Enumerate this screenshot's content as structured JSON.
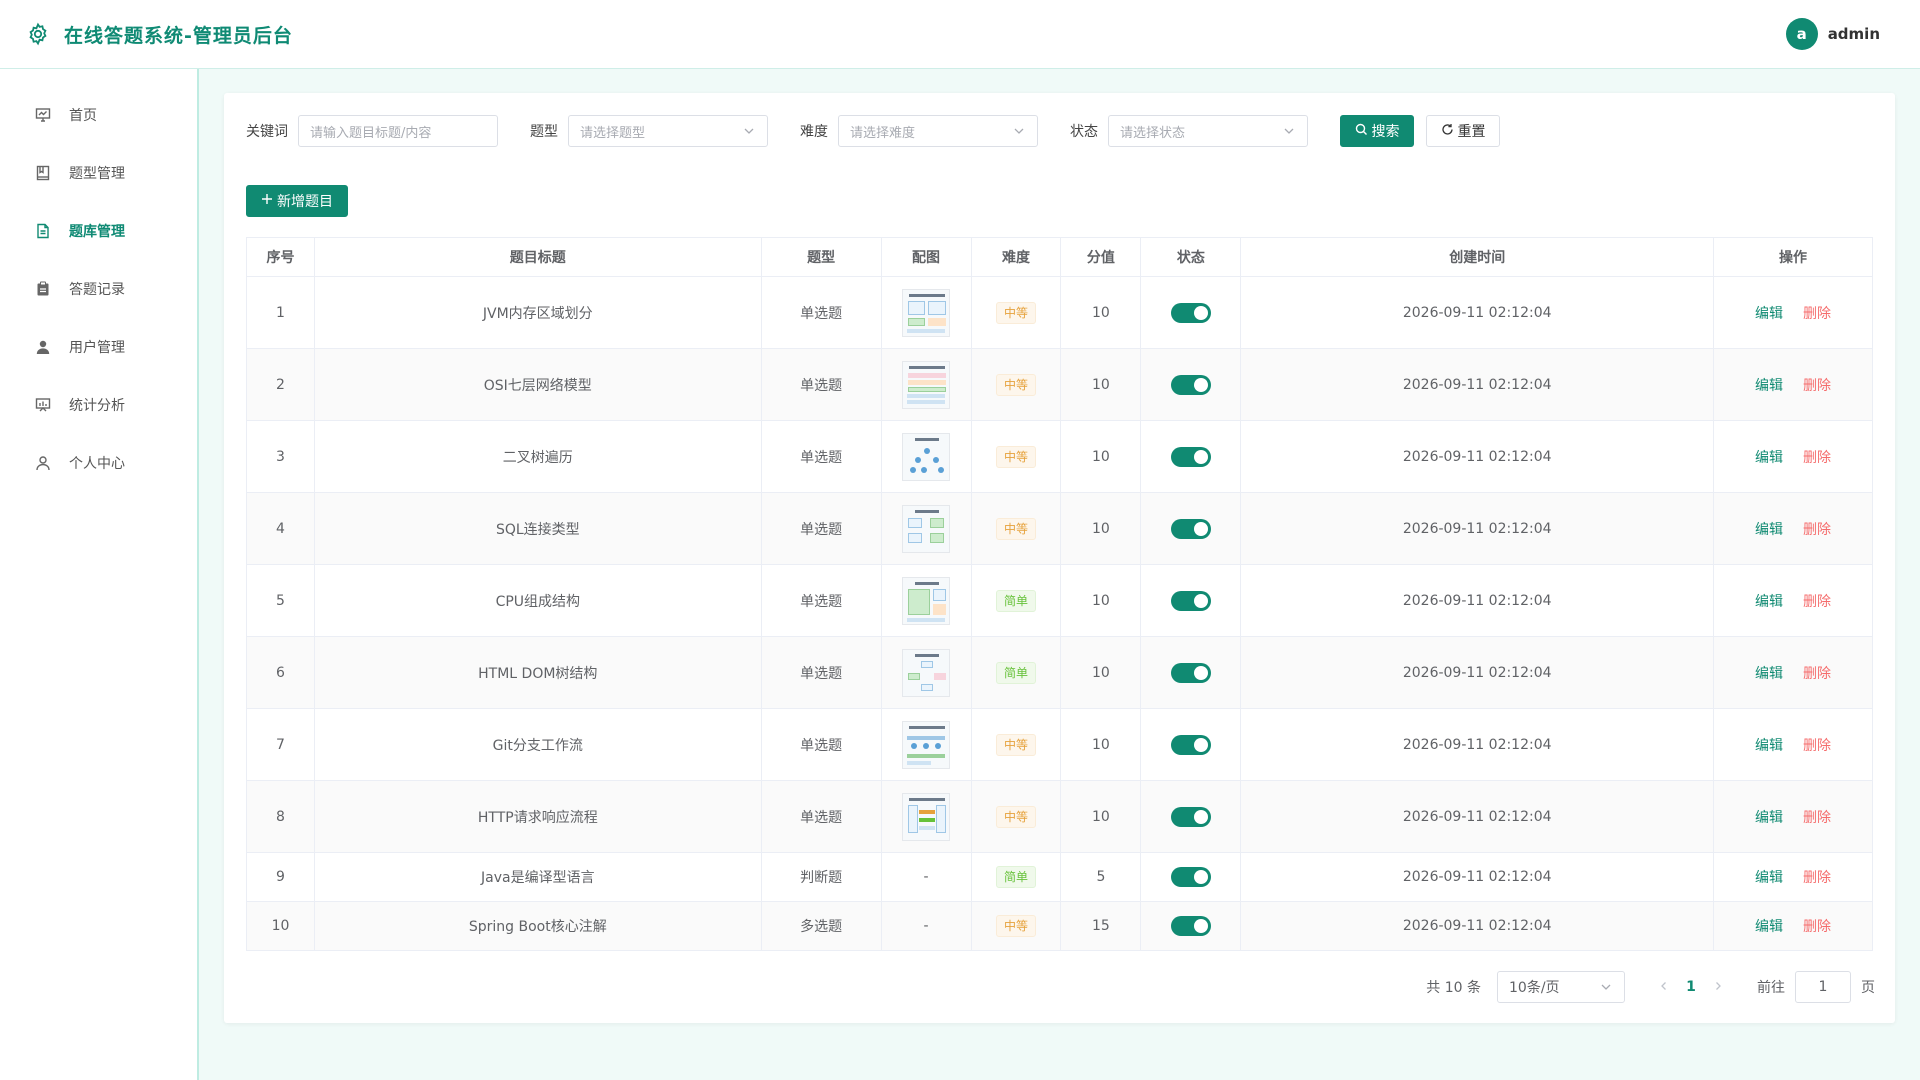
{
  "header": {
    "title": "在线答题系统-管理员后台",
    "user_initial": "a",
    "user_name": "admin"
  },
  "sidebar": {
    "items": [
      {
        "label": "首页",
        "icon": "dashboard-icon",
        "active": false
      },
      {
        "label": "题型管理",
        "icon": "book-icon",
        "active": false
      },
      {
        "label": "题库管理",
        "icon": "document-icon",
        "active": true
      },
      {
        "label": "答题记录",
        "icon": "clipboard-icon",
        "active": false
      },
      {
        "label": "用户管理",
        "icon": "user-icon",
        "active": false
      },
      {
        "label": "统计分析",
        "icon": "chart-board-icon",
        "active": false
      },
      {
        "label": "个人中心",
        "icon": "person-icon",
        "active": false
      }
    ]
  },
  "filters": {
    "keyword_label": "关键词",
    "keyword_placeholder": "请输入题目标题/内容",
    "type_label": "题型",
    "type_placeholder": "请选择题型",
    "difficulty_label": "难度",
    "difficulty_placeholder": "请选择难度",
    "status_label": "状态",
    "status_placeholder": "请选择状态",
    "search_label": "搜索",
    "reset_label": "重置"
  },
  "add_button_label": "新增题目",
  "table": {
    "columns": [
      "序号",
      "题目标题",
      "题型",
      "配图",
      "难度",
      "分值",
      "状态",
      "创建时间",
      "操作"
    ],
    "edit_label": "编辑",
    "delete_label": "删除",
    "rows": [
      {
        "index": "1",
        "title": "JVM内存区域划分",
        "type": "单选题",
        "has_image": true,
        "difficulty": "中等",
        "level": "mid",
        "score": "10",
        "enabled": true,
        "created": "2026-09-11 02:12:04"
      },
      {
        "index": "2",
        "title": "OSI七层网络模型",
        "type": "单选题",
        "has_image": true,
        "difficulty": "中等",
        "level": "mid",
        "score": "10",
        "enabled": true,
        "created": "2026-09-11 02:12:04"
      },
      {
        "index": "3",
        "title": "二叉树遍历",
        "type": "单选题",
        "has_image": true,
        "difficulty": "中等",
        "level": "mid",
        "score": "10",
        "enabled": true,
        "created": "2026-09-11 02:12:04"
      },
      {
        "index": "4",
        "title": "SQL连接类型",
        "type": "单选题",
        "has_image": true,
        "difficulty": "中等",
        "level": "mid",
        "score": "10",
        "enabled": true,
        "created": "2026-09-11 02:12:04"
      },
      {
        "index": "5",
        "title": "CPU组成结构",
        "type": "单选题",
        "has_image": true,
        "difficulty": "简单",
        "level": "easy",
        "score": "10",
        "enabled": true,
        "created": "2026-09-11 02:12:04"
      },
      {
        "index": "6",
        "title": "HTML DOM树结构",
        "type": "单选题",
        "has_image": true,
        "difficulty": "简单",
        "level": "easy",
        "score": "10",
        "enabled": true,
        "created": "2026-09-11 02:12:04"
      },
      {
        "index": "7",
        "title": "Git分支工作流",
        "type": "单选题",
        "has_image": true,
        "difficulty": "中等",
        "level": "mid",
        "score": "10",
        "enabled": true,
        "created": "2026-09-11 02:12:04"
      },
      {
        "index": "8",
        "title": "HTTP请求响应流程",
        "type": "单选题",
        "has_image": true,
        "difficulty": "中等",
        "level": "mid",
        "score": "10",
        "enabled": true,
        "created": "2026-09-11 02:12:04"
      },
      {
        "index": "9",
        "title": "Java是编译型语言",
        "type": "判断题",
        "has_image": false,
        "image_placeholder": "-",
        "difficulty": "简单",
        "level": "easy",
        "score": "5",
        "enabled": true,
        "created": "2026-09-11 02:12:04"
      },
      {
        "index": "10",
        "title": "Spring Boot核心注解",
        "type": "多选题",
        "has_image": false,
        "image_placeholder": "-",
        "difficulty": "中等",
        "level": "mid",
        "score": "15",
        "enabled": true,
        "created": "2026-09-11 02:12:04"
      }
    ]
  },
  "pagination": {
    "total_text": "共 10 条",
    "page_size": "10条/页",
    "current_page": "1",
    "goto_label": "前往",
    "goto_value": "1",
    "page_suffix": "页"
  },
  "colors": {
    "primary": "#108a72",
    "danger": "#f56c6c",
    "warning": "#e6a23c",
    "success": "#67c23a"
  }
}
